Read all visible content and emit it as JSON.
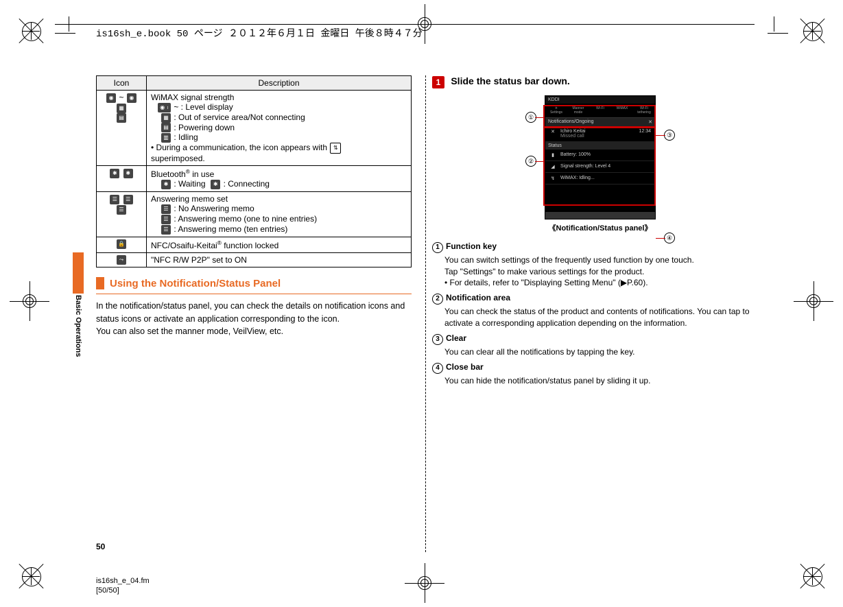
{
  "header_line": "is16sh_e.book  50 ページ ２０１２年６月１日 金曜日 午後８時４７分",
  "table": {
    "head_icon": "Icon",
    "head_desc": "Description",
    "rows": [
      {
        "desc_title": "WiMAX signal strength",
        "items": [
          " ~  : Level display",
          " : Out of service area/Not connecting",
          " : Powering down",
          " : Idling"
        ],
        "note": "• During a communication, the icon appears with ",
        "note2": "  superimposed."
      },
      {
        "desc_title": "Bluetooth® in use",
        "items": [
          " : Waiting   : Connecting"
        ]
      },
      {
        "desc_title": "Answering memo set",
        "items": [
          " : No Answering memo",
          " : Answering memo (one to nine entries)",
          " : Answering memo (ten entries)"
        ]
      },
      {
        "desc_line": "NFC/Osaifu-Keitai® function locked"
      },
      {
        "desc_line": "\"NFC R/W P2P\" set to ON"
      }
    ]
  },
  "section_heading": "Using the Notification/Status Panel",
  "section_body": "In the notification/status panel, you can check the details on notification icons and status icons or activate an application corresponding to the icon.\nYou can also set the manner mode, VeilView, etc.",
  "step": {
    "num": "1",
    "title": "Slide the status bar down."
  },
  "panel": {
    "carrier": "KDDI",
    "fkeys": [
      {
        "l1": "✈",
        "l2": "Settings"
      },
      {
        "l1": "Manner",
        "l2": "mode"
      },
      {
        "l1": "Wi-Fi",
        "l2": ""
      },
      {
        "l1": "WiMAX",
        "l2": ""
      },
      {
        "l1": "Wi-Fi",
        "l2": "tethering"
      }
    ],
    "sec1_title": "Notifications/Ongoing",
    "sec1_action": "✕",
    "noti_line1": "Ichiro Keitai",
    "noti_line2": "Missed call",
    "noti_time": "12:34",
    "sec2_title": "Status",
    "battery": "Battery: 100%",
    "signal": "Signal strength: Level 4",
    "wimax": "WiMAX: Idling...",
    "caption": "《Notification/Status panel》"
  },
  "definitions": [
    {
      "n": "①",
      "t": "Function key",
      "b": "You can switch settings of the frequently used function by one touch.\nTap \"Settings\" to make various settings for the product.\n• For details, refer to \"Displaying Setting Menu\" (▶P.60)."
    },
    {
      "n": "②",
      "t": "Notification area",
      "b": "You can check the status of the product and contents of notifications. You can tap to activate a corresponding application depending on the information."
    },
    {
      "n": "③",
      "t": "Clear",
      "b": "You can clear all the notifications by tapping the key."
    },
    {
      "n": "④",
      "t": "Close bar",
      "b": "You can hide the notification/status panel by sliding it up."
    }
  ],
  "sidetab": "Basic Operations",
  "pagenum": "50",
  "footer1": "is16sh_e_04.fm",
  "footer2": "[50/50]"
}
